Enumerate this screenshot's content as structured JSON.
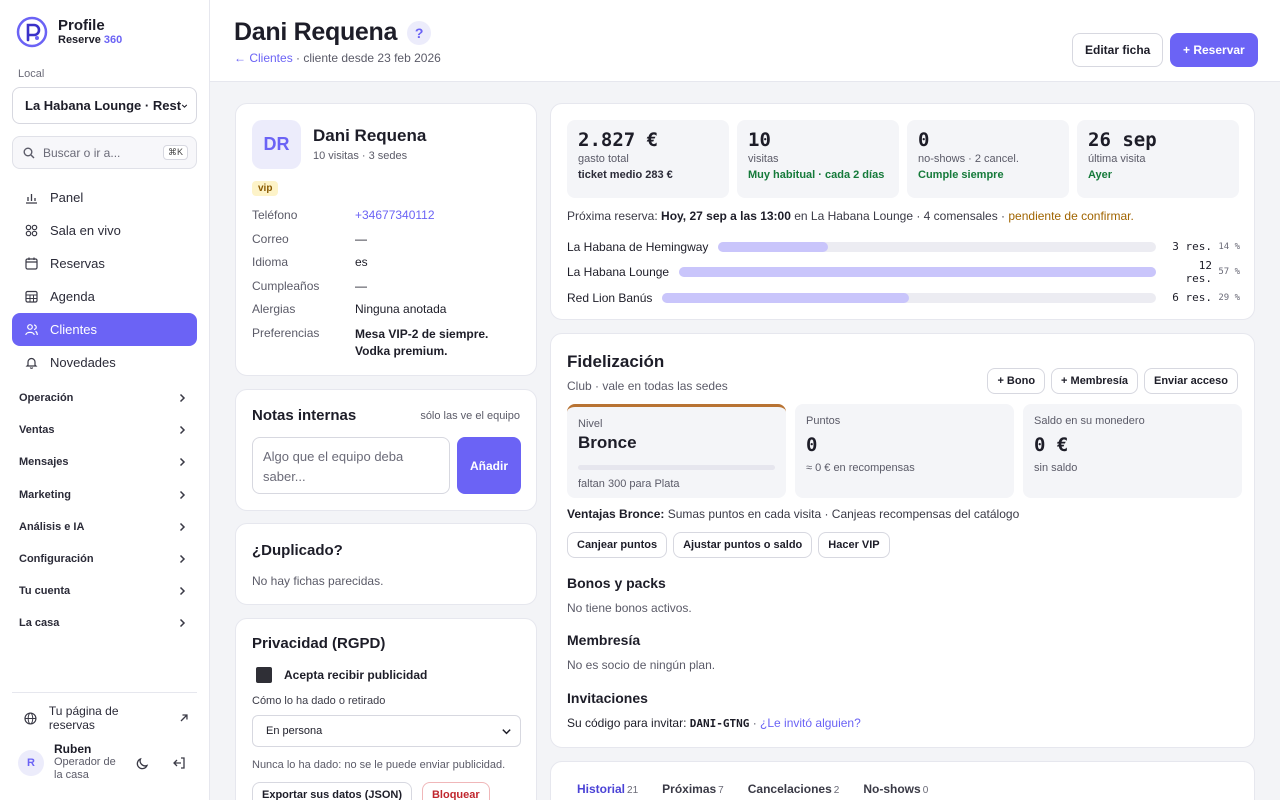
{
  "brand": {
    "name": "Profile",
    "sub_prefix": "Reserve",
    "sub_num": "360"
  },
  "sidebar": {
    "local_label": "Local",
    "local_value": "La Habana Lounge · Rest",
    "search_placeholder": "Buscar o ir a...",
    "search_kbd": "⌘K",
    "nav": [
      {
        "label": "Panel",
        "icon": "bar-chart-icon"
      },
      {
        "label": "Sala en vivo",
        "icon": "grid-icon"
      },
      {
        "label": "Reservas",
        "icon": "calendar-icon"
      },
      {
        "label": "Agenda",
        "icon": "table-calendar-icon"
      },
      {
        "label": "Clientes",
        "icon": "users-icon",
        "active": true
      },
      {
        "label": "Novedades",
        "icon": "bell-icon"
      }
    ],
    "groups": [
      "Operación",
      "Ventas",
      "Mensajes",
      "Marketing",
      "Análisis e IA",
      "Configuración",
      "Tu cuenta",
      "La casa"
    ],
    "booking_link": "Tu página de reservas",
    "user": {
      "initial": "R",
      "name": "Ruben",
      "role": "Operador de la casa"
    }
  },
  "header": {
    "title": "Dani Requena",
    "help": "?",
    "crumb_link": "← Clientes",
    "crumb_text": " · cliente desde 23 feb 2026",
    "edit_button": "Editar ficha",
    "reserve_button": "+ Reservar"
  },
  "profile": {
    "initials": "DR",
    "name": "Dani Requena",
    "sub": "10 visitas · 3 sedes",
    "badge": "vip",
    "fields": {
      "phone_label": "Teléfono",
      "phone": "+34677340112",
      "email_label": "Correo",
      "email": "—",
      "lang_label": "Idioma",
      "lang": "es",
      "bday_label": "Cumpleaños",
      "bday": "—",
      "allergy_label": "Alergias",
      "allergy": "Ninguna anotada",
      "prefs_label": "Preferencias",
      "prefs": "Mesa VIP-2 de siempre. Vodka premium."
    }
  },
  "notes": {
    "title": "Notas internas",
    "hint": "sólo las ve el equipo",
    "placeholder": "Algo que el equipo deba saber...",
    "button": "Añadir"
  },
  "duplicate": {
    "title": "¿Duplicado?",
    "text": "No hay fichas parecidas."
  },
  "privacy": {
    "title": "Privacidad (RGPD)",
    "consent_label": "Acepta recibir publicidad",
    "how_label": "Cómo lo ha dado o retirado",
    "how_value": "En persona",
    "note": "Nunca lo ha dado: no se le puede enviar publicidad.",
    "export_button": "Exportar sus datos (JSON)",
    "block_button": "Bloquear"
  },
  "stats": [
    {
      "value": "2.827 €",
      "label": "gasto total",
      "sub": "ticket medio 283 €",
      "tone": "dark"
    },
    {
      "value": "10",
      "label": "visitas",
      "sub": "Muy habitual · cada 2 días",
      "tone": "green"
    },
    {
      "value": "0",
      "label": "no-shows · 2 cancel.",
      "sub": "Cumple siempre",
      "tone": "green"
    },
    {
      "value": "26 sep",
      "label": "última visita",
      "sub": "Ayer",
      "tone": "green"
    }
  ],
  "next_booking": {
    "prefix": "Próxima reserva: ",
    "when": "Hoy, 27 sep a las 13:00",
    "place": " en La Habana Lounge · 4 comensales · ",
    "status": "pendiente de confirmar."
  },
  "venues": [
    {
      "name": "La Habana de Hemingway",
      "count": "3 res.",
      "pct": "14 %",
      "fraction": 0.25
    },
    {
      "name": "La Habana Lounge",
      "count": "12 res.",
      "pct": "57 %",
      "fraction": 1.0
    },
    {
      "name": "Red Lion Banús",
      "count": "6 res.",
      "pct": "29 %",
      "fraction": 0.5
    }
  ],
  "loyalty": {
    "title": "Fidelización",
    "sub": "Club · vale en todas las sedes",
    "buttons": [
      "+ Bono",
      "+ Membresía",
      "Enviar acceso"
    ],
    "level_label": "Nivel",
    "level": "Bronce",
    "level_progress": 0.0,
    "level_note": "faltan 300 para Plata",
    "points_label": "Puntos",
    "points": "0",
    "points_note": "≈ 0 € en recompensas",
    "wallet_label": "Saldo en su monedero",
    "wallet": "0 €",
    "wallet_note": "sin saldo",
    "benefits_label": "Ventajas Bronce:",
    "benefits": " Sumas puntos en cada visita · Canjeas recompensas del catálogo",
    "actions": [
      "Canjear puntos",
      "Ajustar puntos o saldo",
      "Hacer VIP"
    ],
    "bonos_title": "Bonos y packs",
    "bonos_text": "No tiene bonos activos.",
    "membership_title": "Membresía",
    "membership_text": "No es socio de ningún plan.",
    "invite_title": "Invitaciones",
    "invite_prefix": "Su código para invitar: ",
    "invite_code": "DANI-GTNG",
    "invite_link": "¿Le invitó alguien?"
  },
  "tabs": [
    {
      "label": "Historial",
      "count": "21",
      "active": true
    },
    {
      "label": "Próximas",
      "count": "7"
    },
    {
      "label": "Cancelaciones",
      "count": "2"
    },
    {
      "label": "No-shows",
      "count": "0"
    }
  ],
  "colors": {
    "accent": "#6b63f5",
    "bronze": "#b87333",
    "green": "#157a3a",
    "warn": "#a06400"
  }
}
